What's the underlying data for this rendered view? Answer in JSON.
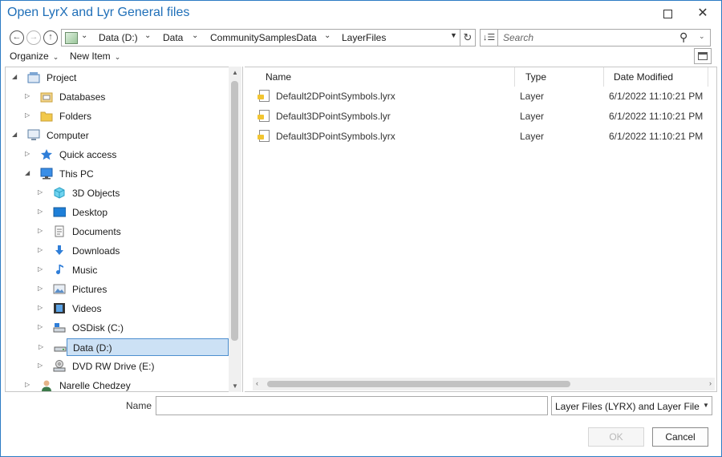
{
  "window": {
    "title": "Open LyrX and Lyr General files",
    "maximize_icon": "maximize-icon",
    "close_glyph": "✕"
  },
  "nav": {
    "back_glyph": "←",
    "forward_glyph": "→",
    "up_glyph": "↑"
  },
  "address": {
    "crumbs": [
      "Data (D:)",
      "Data",
      "CommunitySamplesData",
      "LayerFiles"
    ],
    "chevron": "⌄",
    "dropdown": "▼"
  },
  "refresh_glyph": "↻",
  "sort_glyph": "↓☰",
  "search": {
    "placeholder": "Search",
    "icon_glyph": "⚲",
    "dropdown": "⌄"
  },
  "toolbar": {
    "organize_label": "Organize",
    "new_item_label": "New Item",
    "chevron": "⌄"
  },
  "tree": {
    "expanded_glyph": "◢",
    "collapsed_glyph": "▷",
    "items": [
      {
        "label": "Project",
        "icon": "project-icon",
        "level": 0,
        "state": "expanded"
      },
      {
        "label": "Databases",
        "icon": "database-icon",
        "level": 1,
        "state": "collapsed"
      },
      {
        "label": "Folders",
        "icon": "folder-icon",
        "level": 1,
        "state": "collapsed"
      },
      {
        "label": "Computer",
        "icon": "computer-icon",
        "level": 0,
        "state": "expanded"
      },
      {
        "label": "Quick access",
        "icon": "star-icon",
        "level": 1,
        "state": "collapsed"
      },
      {
        "label": "This PC",
        "icon": "monitor-icon",
        "level": 1,
        "state": "expanded"
      },
      {
        "label": "3D Objects",
        "icon": "cube-icon",
        "level": 2,
        "state": "collapsed"
      },
      {
        "label": "Desktop",
        "icon": "desktop-icon",
        "level": 2,
        "state": "collapsed"
      },
      {
        "label": "Documents",
        "icon": "document-icon",
        "level": 2,
        "state": "collapsed"
      },
      {
        "label": "Downloads",
        "icon": "download-icon",
        "level": 2,
        "state": "collapsed"
      },
      {
        "label": "Music",
        "icon": "music-icon",
        "level": 2,
        "state": "collapsed"
      },
      {
        "label": "Pictures",
        "icon": "pictures-icon",
        "level": 2,
        "state": "collapsed"
      },
      {
        "label": "Videos",
        "icon": "video-icon",
        "level": 2,
        "state": "collapsed"
      },
      {
        "label": "OSDisk (C:)",
        "icon": "os-drive-icon",
        "level": 2,
        "state": "collapsed"
      },
      {
        "label": "Data (D:)",
        "icon": "drive-icon",
        "level": 2,
        "state": "collapsed",
        "selected": true
      },
      {
        "label": "DVD RW Drive (E:)",
        "icon": "dvd-drive-icon",
        "level": 2,
        "state": "collapsed"
      },
      {
        "label": "Narelle Chedzey",
        "icon": "user-icon",
        "level": 1,
        "state": "collapsed"
      }
    ]
  },
  "file_list": {
    "columns": [
      {
        "key": "name",
        "label": "Name"
      },
      {
        "key": "type",
        "label": "Type"
      },
      {
        "key": "date",
        "label": "Date Modified"
      }
    ],
    "rows": [
      {
        "name": "Default2DPointSymbols.lyrx",
        "type": "Layer",
        "date": "6/1/2022 11:10:21 PM",
        "icon": "layer-file-icon"
      },
      {
        "name": "Default3DPointSymbols.lyr",
        "type": "Layer",
        "date": "6/1/2022 11:10:21 PM",
        "icon": "layer-file-icon"
      },
      {
        "name": "Default3DPointSymbols.lyrx",
        "type": "Layer",
        "date": "6/1/2022 11:10:21 PM",
        "icon": "layer-file-icon"
      }
    ]
  },
  "scroll": {
    "up": "▲",
    "down": "▼",
    "left": "‹",
    "right": "›"
  },
  "footer": {
    "name_label": "Name",
    "name_value": "",
    "filetype_value": "Layer Files (LYRX) and Layer Files (L",
    "filetype_dropdown": "▼",
    "ok_label": "OK",
    "cancel_label": "Cancel"
  },
  "colors": {
    "accent": "#1f6fb8",
    "selection": "#cce1f5",
    "selection_border": "#4d8fcf"
  }
}
